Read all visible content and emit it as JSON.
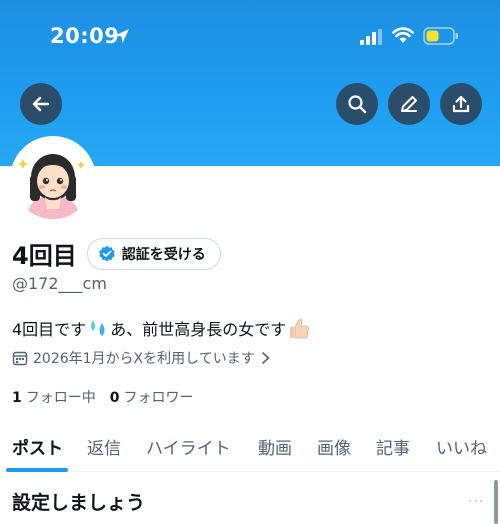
{
  "status_bar": {
    "time": "20:09"
  },
  "profile": {
    "display_name": "4回目",
    "verify_label": "認証を受ける",
    "handle": "@172___cm",
    "bio_part1": "4回目です",
    "bio_part2": "あ、前世高身長の女です",
    "joined": "2026年1月からXを利用しています",
    "following_count": "1",
    "following_label": "フォロー中",
    "followers_count": "0",
    "followers_label": "フォロワー"
  },
  "tabs": [
    {
      "label": "ポスト"
    },
    {
      "label": "返信"
    },
    {
      "label": "ハイライト"
    },
    {
      "label": "動画"
    },
    {
      "label": "画像"
    },
    {
      "label": "記事"
    },
    {
      "label": "いいね"
    }
  ],
  "section": {
    "title": "設定しましょう",
    "more": "···"
  },
  "colors": {
    "banner": "#1e9cf0",
    "accent": "#1d9bf0",
    "icon_button": "#2a4e6a"
  },
  "icons": [
    "back-arrow-icon",
    "search-icon",
    "pencil-icon",
    "share-icon",
    "verified-badge-icon",
    "calendar-icon",
    "chevron-right-icon",
    "sweat-drops-icon",
    "thumbs-up-icon"
  ]
}
